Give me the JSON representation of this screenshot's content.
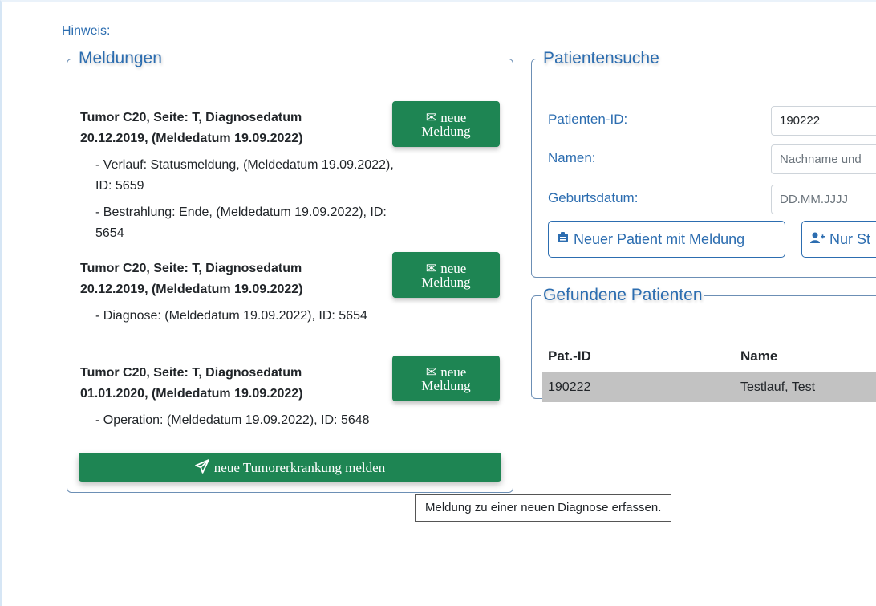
{
  "hinweis": "Hinweis:",
  "meldungen": {
    "legend": "Meldungen",
    "groups": [
      {
        "title": "Tumor C20, Seite: T, Diagnosedatum 20.12.2019, (Meldedatum 19.09.2022)",
        "button": {
          "line1": "neue",
          "line2": "Meldung",
          "icon": "envelope-icon"
        },
        "items": [
          "- Verlauf: Statusmeldung, (Meldedatum 19.09.2022), ID: 5659",
          "- Bestrahlung: Ende, (Meldedatum 19.09.2022), ID: 5654"
        ]
      },
      {
        "title": "Tumor C20, Seite: T, Diagnosedatum 20.12.2019, (Meldedatum 19.09.2022)",
        "button": {
          "line1": "neue",
          "line2": "Meldung",
          "icon": "envelope-icon"
        },
        "items": [
          "- Diagnose: (Meldedatum 19.09.2022), ID: 5654"
        ]
      },
      {
        "title": "Tumor C20, Seite: T, Diagnosedatum 01.01.2020, (Meldedatum 19.09.2022)",
        "button": {
          "line1": "neue",
          "line2": "Meldung",
          "icon": "envelope-icon"
        },
        "items": [
          "- Operation: (Meldedatum 19.09.2022), ID: 5648"
        ]
      }
    ],
    "new_tumor_button": "neue Tumorerkrankung melden"
  },
  "patientensuche": {
    "legend": "Patientensuche",
    "fields": {
      "patient_id_label": "Patienten-ID:",
      "patient_id_value": "190222",
      "name_label": "Namen:",
      "name_placeholder": "Nachname und",
      "birth_label": "Geburtsdatum:",
      "birth_placeholder": "DD.MM.JJJJ"
    },
    "buttons": {
      "new_patient": "Neuer Patient mit Meldung",
      "nur_st": "Nur St"
    }
  },
  "gefundene": {
    "legend": "Gefundene Patienten",
    "columns": [
      "Pat.-ID",
      "Name"
    ],
    "rows": [
      {
        "id": "190222",
        "name": "Testlauf, Test"
      }
    ]
  },
  "tooltip": "Meldung zu einer neuen Diagnose erfassen.",
  "colors": {
    "accent_blue": "#2c6db0",
    "button_green": "#1e8553",
    "selected_row": "#c2c2c2"
  }
}
